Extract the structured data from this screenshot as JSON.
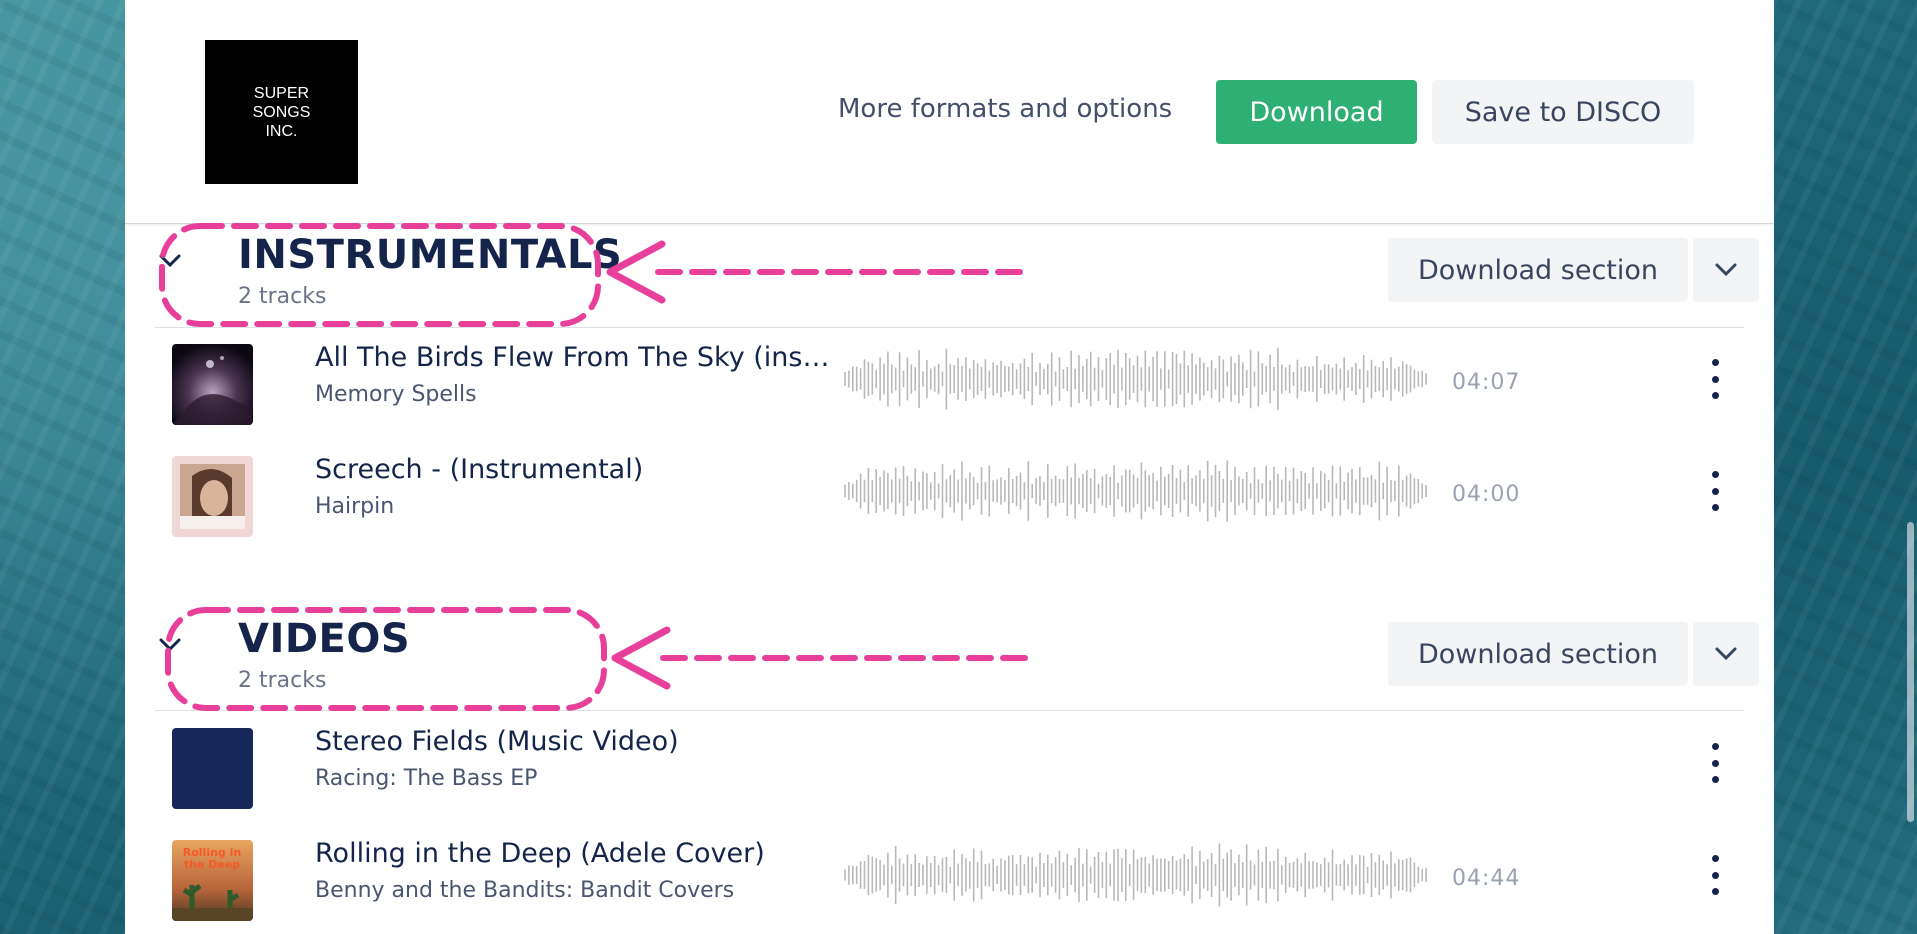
{
  "brand": {
    "logo_lines": [
      "SUPER",
      "SONGS",
      "INC."
    ]
  },
  "header": {
    "more_formats_label": "More formats and options",
    "download_label": "Download",
    "save_label": "Save to DISCO",
    "download_color": "#2eaf74"
  },
  "sections": [
    {
      "title": "INSTRUMENTALS",
      "count": "2 tracks",
      "download_section_label": "Download section",
      "tracks": [
        {
          "title": "All The Birds Flew From The Sky (instru...",
          "artist": "Memory Spells",
          "duration": "04:07",
          "has_waveform": true
        },
        {
          "title": "Screech - (Instrumental)",
          "artist": "Hairpin",
          "duration": "04:00",
          "has_waveform": true
        }
      ]
    },
    {
      "title": "VIDEOS",
      "count": "2 tracks",
      "download_section_label": "Download section",
      "tracks": [
        {
          "title": "Stereo Fields (Music Video)",
          "artist": "Racing: The Bass EP",
          "duration": "",
          "has_waveform": false
        },
        {
          "title": "Rolling in the Deep (Adele Cover)",
          "artist": "Benny and the Bandits: Bandit Covers",
          "duration": "04:44",
          "has_waveform": true
        }
      ]
    }
  ],
  "annotation_color": "#e8409a",
  "icons": {
    "section_toggle": "chevron-down-icon",
    "section_menu": "chevron-down-icon",
    "track_menu": "more-vertical-icon"
  }
}
